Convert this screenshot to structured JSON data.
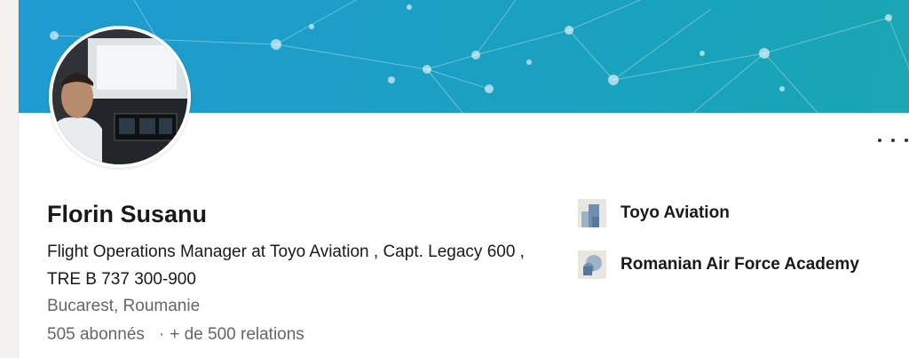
{
  "profile": {
    "name": "Florin Susanu",
    "headline": "Flight Operations Manager at Toyo Aviation , Capt. Legacy 600 , TRE B 737 300-900",
    "location": "Bucarest, Roumanie",
    "followers": "505 abonnés",
    "separator": "·",
    "connections": "+ de 500 relations"
  },
  "experience": [
    {
      "label": "Toyo Aviation",
      "icon": "company-logo-icon"
    },
    {
      "label": "Romanian Air Force Academy",
      "icon": "school-logo-icon"
    }
  ],
  "colors": {
    "banner": "#1c9ec8",
    "text": "#191919",
    "secondary_text": "#666666"
  },
  "icons": {
    "more": "more-horizontal-icon"
  }
}
